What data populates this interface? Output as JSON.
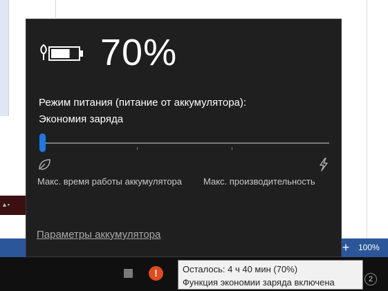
{
  "flyout": {
    "percent": "70%",
    "mode_label": "Режим питания (питание от аккумулятора):",
    "mode_value": "Экономия заряда",
    "slider_min_label": "Макс. время работы аккумулятора",
    "slider_max_label": "Макс. производительность",
    "settings_link": "Параметры аккумулятора",
    "battery_level": 0.7,
    "accent_color": "#1e78e6"
  },
  "tooltip": {
    "line1": "Осталось: 4 ч 40 мин (70%)",
    "line2": "Функция экономии заряда включена"
  },
  "statusbar": {
    "plus": "+",
    "zoom": "100%"
  },
  "taskbar": {
    "alert_glyph": "!",
    "badge_number": "2"
  }
}
